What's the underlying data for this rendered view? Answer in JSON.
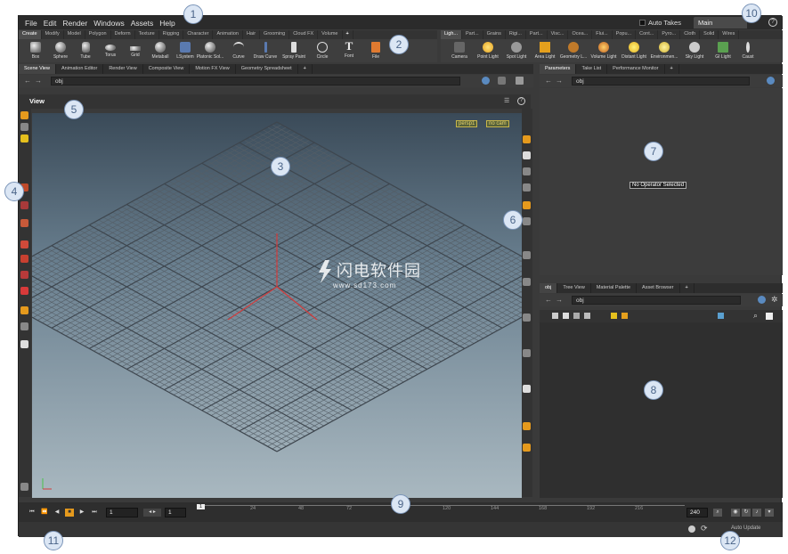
{
  "menubar": {
    "items": [
      "File",
      "Edit",
      "Render",
      "Windows",
      "Assets",
      "Help"
    ],
    "auto_takes": "Auto Takes",
    "desktop_tab": "Main"
  },
  "shelf": {
    "left_tabs": [
      "Create",
      "Modify",
      "Model",
      "Polygon",
      "Deform",
      "Texture",
      "Rigging",
      "Character",
      "Animation",
      "Hair",
      "Grooming",
      "Cloud FX",
      "Volume"
    ],
    "left_tools": [
      "Box",
      "Sphere",
      "Tube",
      "Torus",
      "Grid",
      "Metaball",
      "LSystem",
      "Platonic Sol...",
      "Curve",
      "Draw Curve",
      "Spray Paint",
      "Circle",
      "Font",
      "File"
    ],
    "right_tabs": [
      "Ligh...",
      "Part...",
      "Grains",
      "Rigi...",
      "Part...",
      "Visc...",
      "Ocea...",
      "Flui...",
      "Popu...",
      "Cont...",
      "Pyro...",
      "Cloth",
      "Solid",
      "Wires"
    ],
    "right_tools": [
      "Camera",
      "Point Light",
      "Spot Light",
      "Area Light",
      "Geometry L...",
      "Volume Light",
      "Distant Light",
      "Environmen...",
      "Sky Light",
      "GI Light",
      "Caust"
    ]
  },
  "scene_pane": {
    "tabs": [
      "Scene View",
      "Animation Editor",
      "Render View",
      "Composite View",
      "Motion FX View",
      "Geometry Spreadsheet"
    ],
    "path": "obj",
    "view_label": "View",
    "persp_badge": "persp1",
    "cam_badge": "no cam"
  },
  "param_pane": {
    "tabs": [
      "Parameters",
      "Take List",
      "Performance Monitor"
    ],
    "path": "obj",
    "message": "No Operator Selected"
  },
  "network_pane": {
    "tabs": [
      "obj",
      "Tree View",
      "Material Palette",
      "Asset Browser"
    ],
    "path": "obj"
  },
  "timeline": {
    "current_frame": "1",
    "start_frame": "1",
    "ruler_start": "1",
    "ticks": [
      "24",
      "48",
      "72",
      "96",
      "120",
      "144",
      "168",
      "192",
      "216"
    ],
    "end_frame": "240"
  },
  "status": {
    "update_mode": "Auto Update"
  },
  "watermark": {
    "title": "闪电软件园",
    "url": "www.sd173.com"
  },
  "callouts": [
    "1",
    "2",
    "3",
    "4",
    "5",
    "6",
    "7",
    "8",
    "9",
    "10",
    "11",
    "12"
  ],
  "colors": {
    "accent": "#e59a1d",
    "callout_fill": "#dbe6f4",
    "callout_text": "#4a6488"
  }
}
